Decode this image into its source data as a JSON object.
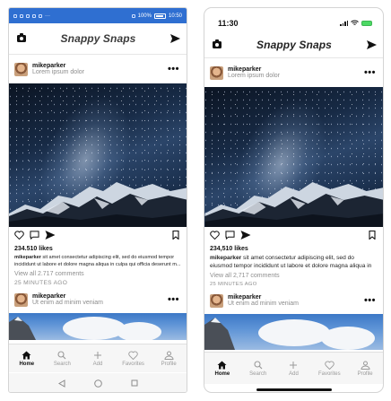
{
  "android": {
    "status": {
      "right_text": "100%",
      "time": "10:50"
    }
  },
  "ios": {
    "status": {
      "time": "11:30"
    }
  },
  "app": {
    "title": "Snappy Snaps"
  },
  "post": {
    "username": "mikeparker",
    "subtitle": "Lorem ipsum dolor",
    "likes": "234.510 likes",
    "likes_ios": "234,510 likes",
    "caption_user": "mikeparker",
    "caption_text": " sit amet consectetur adipiscing elit, sed do eiusmod tempor incididunt ut labore et dolore magna aliqua in culpa qui officia deserunt m...",
    "caption_text_ios": " sit amet consectetur adipiscing elit, sed do eiusmod tempor incididunt ut labore et dolore magna aliqua in",
    "comments": "View all 2.717 comments",
    "comments_ios": "View all 2,717 comments",
    "time_ago": "25 MINUTES AGO"
  },
  "post2": {
    "username": "mikeparker",
    "subtitle": "Ut enim ad minim veniam"
  },
  "tabs": [
    {
      "label": "Home",
      "icon": "home-icon"
    },
    {
      "label": "Search",
      "icon": "search-icon"
    },
    {
      "label": "Add",
      "icon": "add-icon"
    },
    {
      "label": "Favorites",
      "icon": "heart-icon"
    },
    {
      "label": "Profile",
      "icon": "profile-icon"
    }
  ],
  "colors": {
    "android_status": "#2f6fd1",
    "ios_battery": "#4cd964"
  }
}
